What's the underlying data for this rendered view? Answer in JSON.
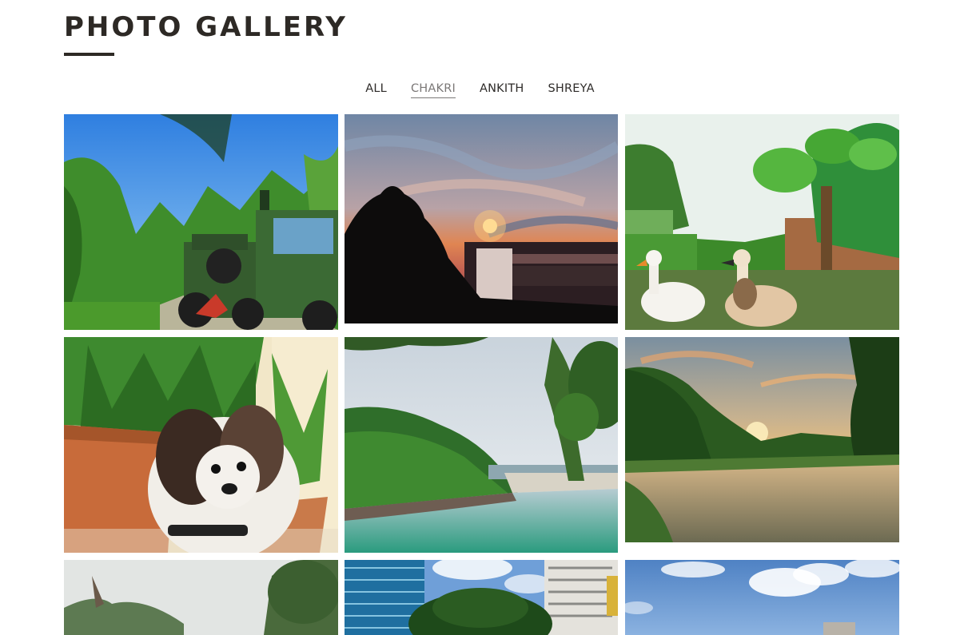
{
  "header": {
    "title": "PHOTO GALLERY"
  },
  "filters": [
    {
      "label": "ALL",
      "active": false
    },
    {
      "label": "CHAKRI",
      "active": true
    },
    {
      "label": "ANKITH",
      "active": false
    },
    {
      "label": "SHREYA",
      "active": false
    }
  ],
  "gallery": {
    "photos": [
      {
        "subject": "army-truck-forest-road"
      },
      {
        "subject": "sunset-behind-building"
      },
      {
        "subject": "geese-garden-taro-plants"
      },
      {
        "subject": "shih-tzu-puppy-potted-plants"
      },
      {
        "subject": "river-gorge-green-water"
      },
      {
        "subject": "sunset-pond-reflection"
      },
      {
        "subject": "hills-trees-sky"
      },
      {
        "subject": "city-towers-tree"
      },
      {
        "subject": "blue-sky-clouds-building"
      }
    ]
  }
}
